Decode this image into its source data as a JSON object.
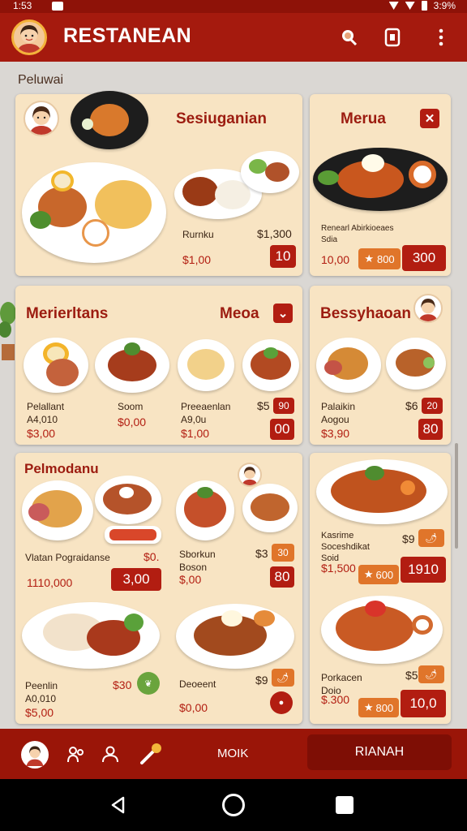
{
  "status": {
    "time": "1:53",
    "battery": "3:9%"
  },
  "app": {
    "title": "RESTANEAN"
  },
  "section": {
    "title": "Peluwai"
  },
  "cards": {
    "c1": {
      "title": "Sesiuganian",
      "item_name": "Rurnku",
      "price_a": "$1,00",
      "price_b": "$1,300",
      "button": "10"
    },
    "c2": {
      "title": "Merua",
      "line1": "Renearl Abirkioeaes",
      "line2": "Sdia",
      "price": "10,00",
      "btn_orange": "800",
      "button": "300"
    },
    "c3": {
      "title": "Merierltans",
      "title_right": "Meoa",
      "items": [
        {
          "name": "Pelallant",
          "sub": "A4,010",
          "price": "$3,00"
        },
        {
          "name": "Soom",
          "price": "$0,00"
        },
        {
          "name": "Preeaenlan",
          "sub": "A9,0u",
          "price": "$1,00"
        }
      ],
      "price_top": "$5",
      "badge_small": "90",
      "button": "00"
    },
    "c4": {
      "title": "Bessyhaoan",
      "item_name": "Palaikin",
      "sub": "Aogou",
      "price": "$3,90",
      "price_top": "$6",
      "badge_small": "20",
      "button": "80"
    },
    "c5": {
      "title": "Pelmodanu",
      "row1_name": "Vlatan Pograidanse",
      "row1_mid": "$0.",
      "row1_price": "1110,000",
      "row1_button": "3,00",
      "row1b_name": "Sborkun",
      "row1b_sub": "Boson",
      "row1b_price": "$,00",
      "row1b_top": "$3",
      "row1b_badge": "30",
      "row1b_button": "80",
      "row2_name": "Peenlin",
      "row2_sub": "A0,010",
      "row2_price": "$5,00",
      "row2_mid": "$30",
      "row2b_name": "Deoeent",
      "row2b_price": "$0,00",
      "row2b_top": "$9"
    },
    "c6": {
      "item1_name": "Kasrime",
      "item1_line2": "Soceshdikat",
      "item1_line3": "Soid",
      "item1_price": "$1,500",
      "item1_top": "$9",
      "item1_orange": "600",
      "item1_button": "1910",
      "item2_name": "Porkacen",
      "item2_line2": "Doio",
      "item2_price": "$.300",
      "item2_top": "$5",
      "item2_orange": "800",
      "item2_button": "10,0"
    }
  },
  "bottom_nav": {
    "middle_label": "MOIK",
    "cta_label": "RIANAH"
  },
  "icons": {
    "app_avatar": "avatar-icon",
    "header_actions": [
      "face-scan-icon",
      "tablet-icon",
      "more-vert-icon"
    ],
    "bottom": [
      "profile-icon",
      "people-icon",
      "user-icon",
      "magic-wand-icon"
    ],
    "system": [
      "back-icon",
      "home-icon",
      "recents-icon"
    ]
  },
  "colors": {
    "brand": "#a51a0e",
    "card": "#f8e4c3",
    "accent": "#b21d11",
    "orange": "#e0752a"
  }
}
